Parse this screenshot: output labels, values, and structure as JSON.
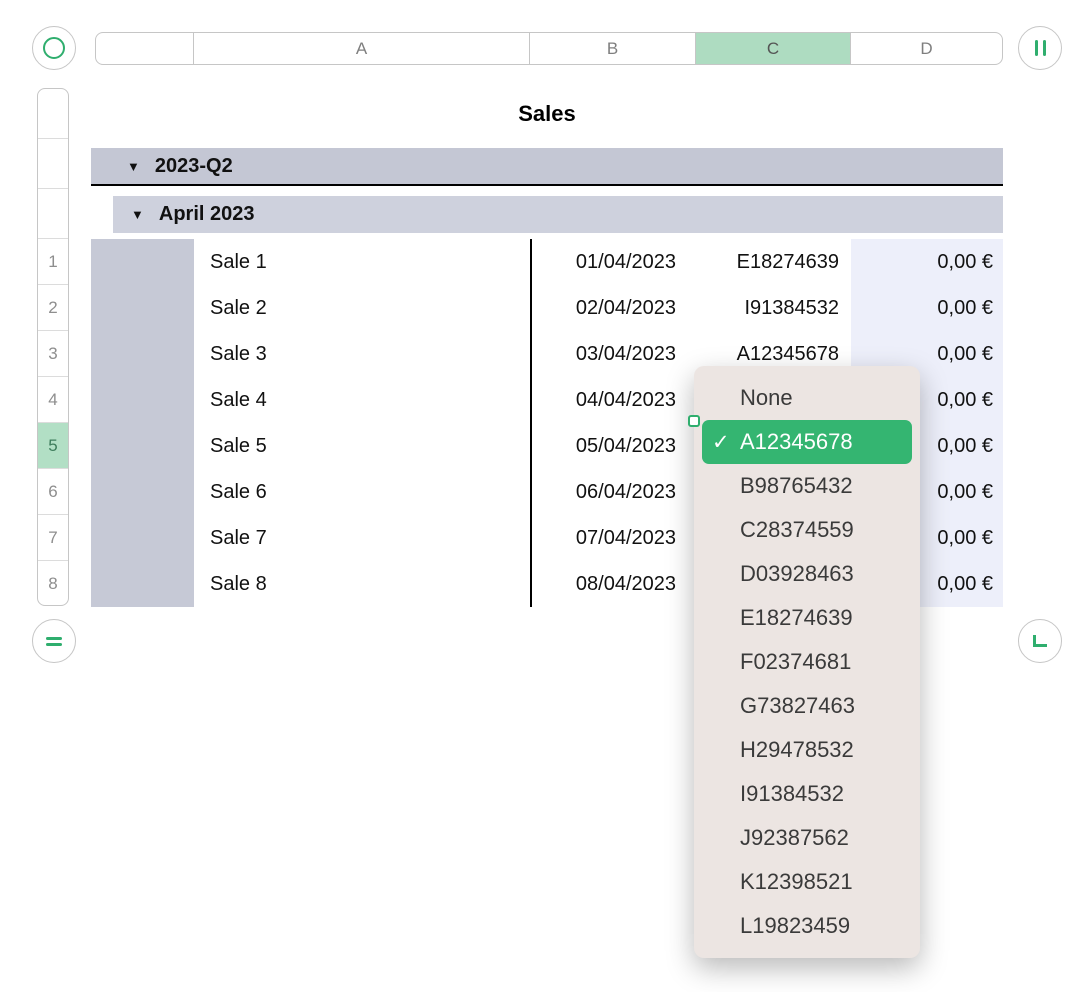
{
  "colors": {
    "accent_green": "#2fae6e",
    "dropdown_selected_green": "#34b571",
    "selection_green": "#b2dfc5",
    "group_band_gray": "#c4c7d4",
    "value_column_bg": "#edeffa",
    "popup_bg": "#ece5e2"
  },
  "header": {
    "columns": [
      {
        "label": ""
      },
      {
        "label": "A"
      },
      {
        "label": "B"
      },
      {
        "label": "C",
        "selected": true
      },
      {
        "label": "D"
      }
    ]
  },
  "table": {
    "title": "Sales",
    "group1": {
      "icon": "▼",
      "label": "2023-Q2"
    },
    "group2": {
      "icon": "▼",
      "label": "April 2023"
    },
    "rows": [
      {
        "num": "1",
        "name": "Sale 1",
        "date": "01/04/2023",
        "code": "E18274639",
        "value": "0,00 €"
      },
      {
        "num": "2",
        "name": "Sale 2",
        "date": "02/04/2023",
        "code": "I91384532",
        "value": "0,00 €"
      },
      {
        "num": "3",
        "name": "Sale 3",
        "date": "03/04/2023",
        "code": "A12345678",
        "value": "0,00 €"
      },
      {
        "num": "4",
        "name": "Sale 4",
        "date": "04/04/2023",
        "code": "",
        "value": "0,00 €"
      },
      {
        "num": "5",
        "name": "Sale 5",
        "date": "05/04/2023",
        "code": "",
        "value": "0,00 €"
      },
      {
        "num": "6",
        "name": "Sale 6",
        "date": "06/04/2023",
        "code": "",
        "value": "0,00 €"
      },
      {
        "num": "7",
        "name": "Sale 7",
        "date": "07/04/2023",
        "code": "",
        "value": "0,00 €"
      },
      {
        "num": "8",
        "name": "Sale 8",
        "date": "08/04/2023",
        "code": "",
        "value": "0,00 €"
      }
    ]
  },
  "dropdown": {
    "check_icon": "✓",
    "selected": "A12345678",
    "options": [
      "None",
      "A12345678",
      "B98765432",
      "C28374559",
      "D03928463",
      "E18274639",
      "F02374681",
      "G73827463",
      "H29478532",
      "I91384532",
      "J92387562",
      "K12398521",
      "L19823459"
    ]
  }
}
